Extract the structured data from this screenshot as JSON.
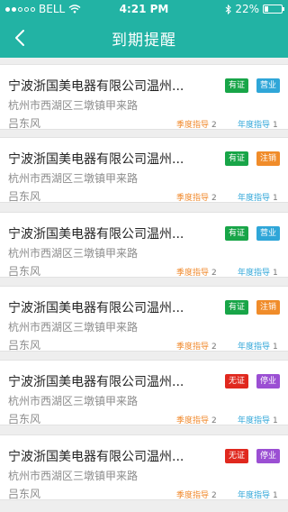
{
  "status_bar": {
    "carrier": "BELL",
    "time": "4:21 PM",
    "battery": "22%",
    "battery_level": 0.22
  },
  "nav": {
    "title": "到期提醒",
    "back_icon": "chevron-left-icon"
  },
  "colors": {
    "primary": "#22b3a4",
    "license_green": "#18a548",
    "license_red": "#e0281e",
    "status_blue": "#2fa6d8",
    "status_orange": "#f08c2a",
    "status_purple": "#9b4fd3",
    "quarter_label": "#f0892c",
    "year_label": "#2fa6d8"
  },
  "items": [
    {
      "name": "宁波浙国美电器有限公司温州...",
      "address": "杭州市西湖区三墩镇甲来路",
      "person": "吕东风",
      "license_tag": "有证",
      "status_tag": "营业",
      "quarter_label": "季度指导",
      "quarter_count": "2",
      "year_label": "年度指导",
      "year_count": "1"
    },
    {
      "name": "宁波浙国美电器有限公司温州...",
      "address": "杭州市西湖区三墩镇甲来路",
      "person": "吕东风",
      "license_tag": "有证",
      "status_tag": "注销",
      "quarter_label": "季度指导",
      "quarter_count": "2",
      "year_label": "年度指导",
      "year_count": "1"
    },
    {
      "name": "宁波浙国美电器有限公司温州...",
      "address": "杭州市西湖区三墩镇甲来路",
      "person": "吕东风",
      "license_tag": "有证",
      "status_tag": "营业",
      "quarter_label": "季度指导",
      "quarter_count": "2",
      "year_label": "年度指导",
      "year_count": "1"
    },
    {
      "name": "宁波浙国美电器有限公司温州...",
      "address": "杭州市西湖区三墩镇甲来路",
      "person": "吕东风",
      "license_tag": "有证",
      "status_tag": "注销",
      "quarter_label": "季度指导",
      "quarter_count": "2",
      "year_label": "年度指导",
      "year_count": "1"
    },
    {
      "name": "宁波浙国美电器有限公司温州...",
      "address": "杭州市西湖区三墩镇甲来路",
      "person": "吕东风",
      "license_tag": "无证",
      "status_tag": "停业",
      "quarter_label": "季度指导",
      "quarter_count": "2",
      "year_label": "年度指导",
      "year_count": "1"
    },
    {
      "name": "宁波浙国美电器有限公司温州...",
      "address": "杭州市西湖区三墩镇甲来路",
      "person": "吕东风",
      "license_tag": "无证",
      "status_tag": "停业",
      "quarter_label": "季度指导",
      "quarter_count": "2",
      "year_label": "年度指导",
      "year_count": "1"
    }
  ]
}
